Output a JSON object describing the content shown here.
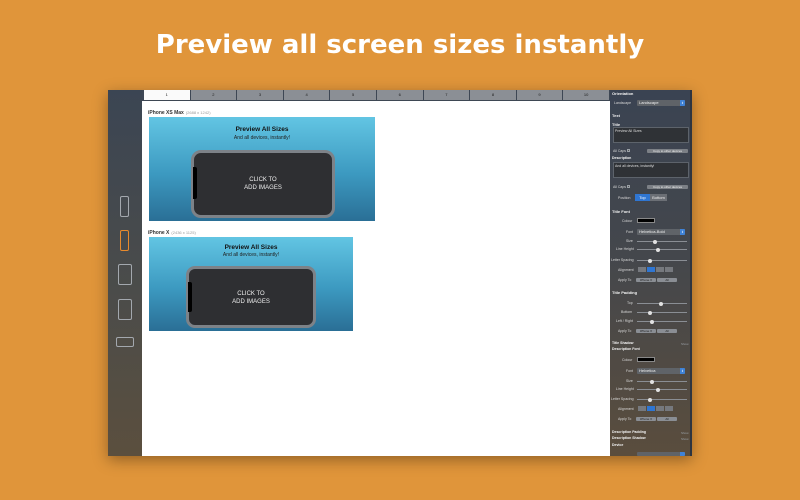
{
  "headline": "Preview all screen sizes instantly",
  "tabs": [
    "1",
    "2",
    "3",
    "4",
    "5",
    "6",
    "7",
    "8",
    "9",
    "10"
  ],
  "devices": [
    {
      "label": "iPhone XS Max",
      "dims": "(2688 x 1242)"
    },
    {
      "label": "iPhone X",
      "dims": "(2436 x 1125)"
    }
  ],
  "preview": {
    "title": "Preview All Sizes",
    "description": "And all devices, instantly!",
    "cta_line1": "CLICK TO",
    "cta_line2": "ADD IMAGES"
  },
  "inspector": {
    "orientation_header": "Orientation",
    "orientation_label": "Landscape",
    "orientation_value": "Landscape",
    "text_header": "Text",
    "title_label": "Title",
    "title_value": "Preview All Sizes",
    "all_caps": "All Caps",
    "copy_btn": "Copy to other devices",
    "description_label": "Description",
    "description_value": "And all devices, instantly!",
    "position_label": "Position",
    "pos_top": "Top",
    "pos_bottom": "Bottom",
    "title_font_header": "Title Font",
    "colour_label": "Colour",
    "font_label": "Font",
    "title_font_value": "Helvetica-Bold",
    "desc_font_value": "Helvetica",
    "size_label": "Size",
    "line_height_label": "Line Height",
    "letter_spacing_label": "Letter Spacing",
    "alignment_label": "Alignment",
    "apply_to_label": "Apply To",
    "apply_iphone": "iPhone X",
    "apply_all": "All",
    "title_padding_header": "Title Padding",
    "top_label": "Top",
    "bottom_label": "Bottom",
    "left_right_label": "Left / Right",
    "title_shadow_header": "Title Shadow",
    "show": "Show",
    "description_font_header": "Description Font",
    "description_padding_header": "Description Padding",
    "description_shadow_header": "Description Shadow",
    "device_header": "Device"
  }
}
